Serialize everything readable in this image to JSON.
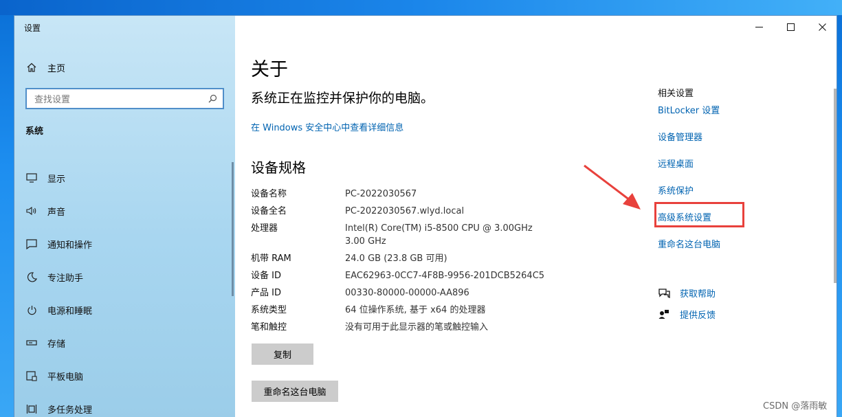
{
  "window": {
    "title": "设置"
  },
  "sidebar": {
    "home_label": "主页",
    "search_placeholder": "查找设置",
    "section": "系统",
    "items": [
      {
        "label": "显示",
        "icon": "monitor-icon"
      },
      {
        "label": "声音",
        "icon": "speaker-icon"
      },
      {
        "label": "通知和操作",
        "icon": "notification-icon"
      },
      {
        "label": "专注助手",
        "icon": "moon-icon"
      },
      {
        "label": "电源和睡眠",
        "icon": "power-icon"
      },
      {
        "label": "存储",
        "icon": "storage-icon"
      },
      {
        "label": "平板电脑",
        "icon": "tablet-icon"
      },
      {
        "label": "多任务处理",
        "icon": "multitask-icon"
      }
    ]
  },
  "main": {
    "title": "关于",
    "protect_text": "系统正在监控并保护你的电脑。",
    "security_link": "在 Windows 安全中心中查看详细信息",
    "spec_heading": "设备规格",
    "specs": [
      {
        "key": "设备名称",
        "value": "PC-2022030567"
      },
      {
        "key": "设备全名",
        "value": "PC-2022030567.wlyd.local"
      },
      {
        "key": "处理器",
        "value": "Intel(R) Core(TM) i5-8500 CPU @ 3.00GHz   3.00 GHz"
      },
      {
        "key": "机带 RAM",
        "value": "24.0 GB (23.8 GB 可用)"
      },
      {
        "key": "设备 ID",
        "value": "EAC62963-0CC7-4F8B-9956-201DCB5264C5"
      },
      {
        "key": "产品 ID",
        "value": "00330-80000-00000-AA896"
      },
      {
        "key": "系统类型",
        "value": "64 位操作系统, 基于 x64 的处理器"
      },
      {
        "key": "笔和触控",
        "value": "没有可用于此显示器的笔或触控输入"
      }
    ],
    "copy_button": "复制",
    "rename_button": "重命名这台电脑"
  },
  "related": {
    "heading": "相关设置",
    "links": [
      "BitLocker 设置",
      "设备管理器",
      "远程桌面",
      "系统保护",
      "高级系统设置",
      "重命名这台电脑"
    ]
  },
  "help": {
    "get_help": "获取帮助",
    "feedback": "提供反馈"
  },
  "watermark": "CSDN @落雨敏",
  "colors": {
    "link": "#0063b1",
    "highlight": "#e8413c",
    "sidebar": "#b3dcf2"
  }
}
